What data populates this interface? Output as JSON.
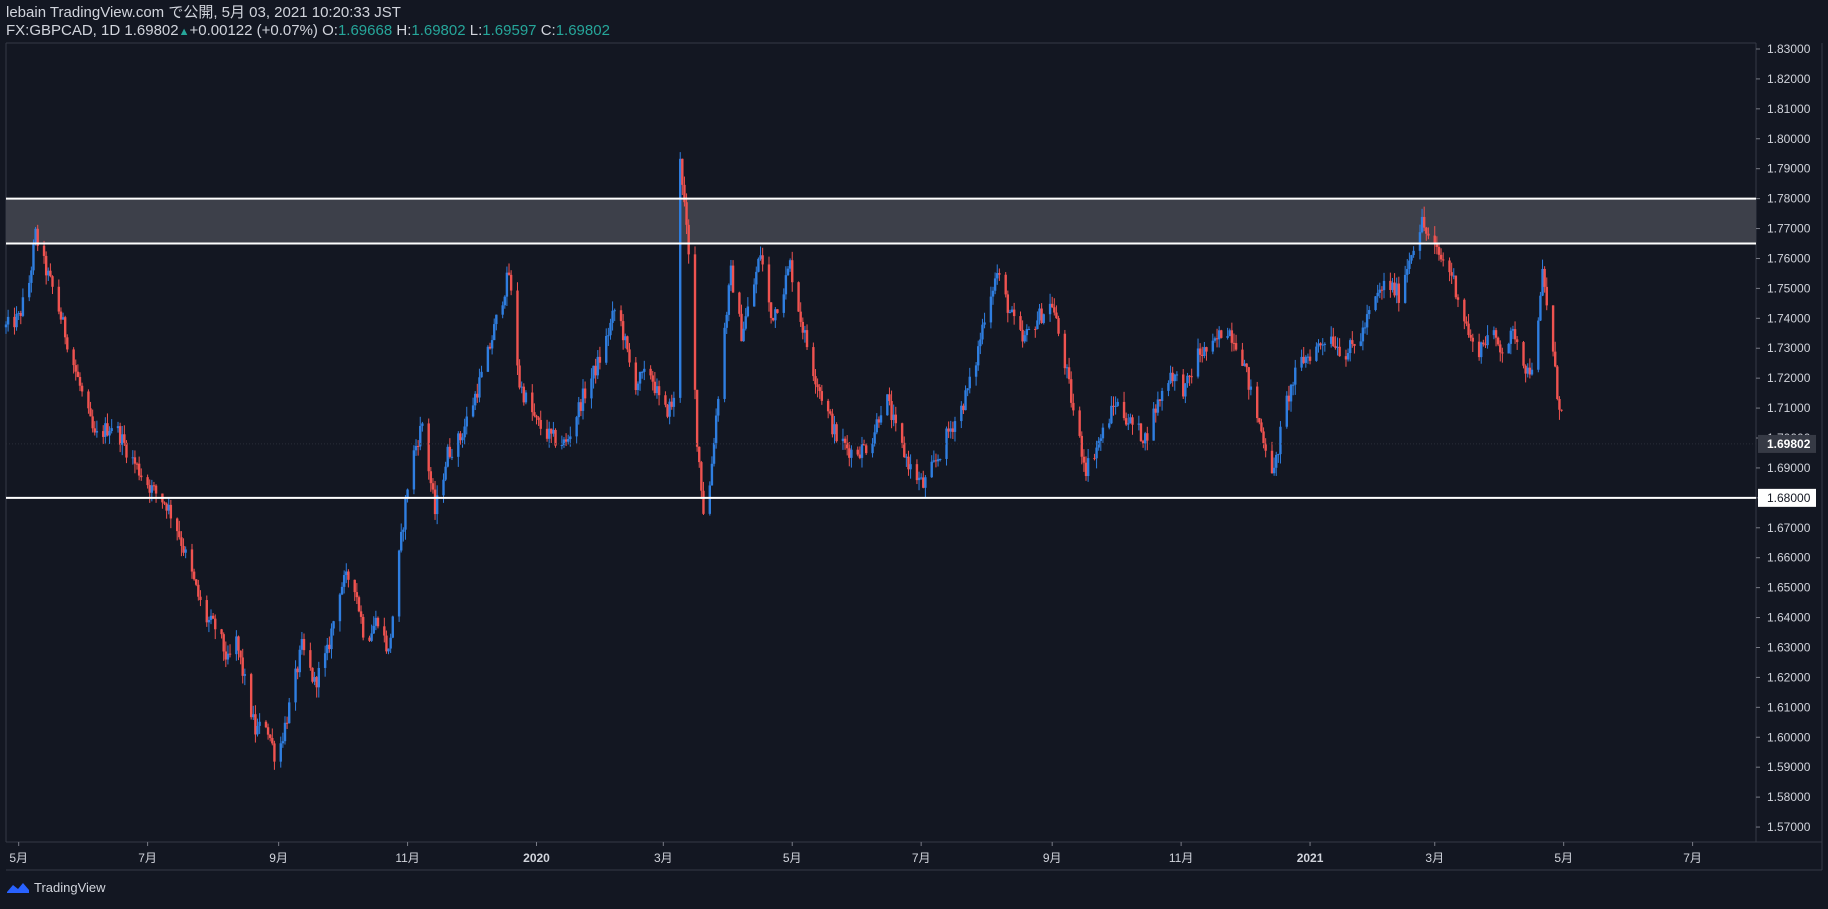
{
  "header": {
    "line1": "lebain TradingView.com で公開, 5月 03, 2021 10:20:33 JST",
    "symbol": "FX:GBPCAD, 1D",
    "last": "1.69802",
    "change": "+0.00122 (+0.07%)",
    "o_key": "O:",
    "o_val": "1.69668",
    "h_key": "H:",
    "h_val": "1.69802",
    "l_key": "L:",
    "l_val": "1.69597",
    "c_key": "C:",
    "c_val": "1.69802"
  },
  "footer": {
    "brand": "TradingView"
  },
  "colors": {
    "bg": "#131722",
    "up": "#2f7ee0",
    "down": "#ef5350",
    "grid": "#363a45",
    "text": "#d1d4dc",
    "zone": "#3d404a"
  },
  "chart_data": {
    "type": "candlestick",
    "title": "FX:GBPCAD, 1D",
    "ylim": [
      1.565,
      1.832
    ],
    "y_ticks": [
      "1.57000",
      "1.58000",
      "1.59000",
      "1.60000",
      "1.61000",
      "1.62000",
      "1.63000",
      "1.64000",
      "1.65000",
      "1.66000",
      "1.67000",
      "1.68000",
      "1.69000",
      "1.70000",
      "1.71000",
      "1.72000",
      "1.73000",
      "1.74000",
      "1.75000",
      "1.76000",
      "1.77000",
      "1.78000",
      "1.79000",
      "1.80000",
      "1.81000",
      "1.82000",
      "1.83000"
    ],
    "x_range": [
      "2019-04-25",
      "2021-07-31"
    ],
    "x_ticks": [
      {
        "date": "2019-05-01",
        "label": "5月"
      },
      {
        "date": "2019-07-01",
        "label": "7月"
      },
      {
        "date": "2019-09-01",
        "label": "9月"
      },
      {
        "date": "2019-11-01",
        "label": "11月"
      },
      {
        "date": "2020-01-01",
        "label": "2020"
      },
      {
        "date": "2020-03-01",
        "label": "3月"
      },
      {
        "date": "2020-05-01",
        "label": "5月"
      },
      {
        "date": "2020-07-01",
        "label": "7月"
      },
      {
        "date": "2020-09-01",
        "label": "9月"
      },
      {
        "date": "2020-11-01",
        "label": "11月"
      },
      {
        "date": "2021-01-01",
        "label": "2021"
      },
      {
        "date": "2021-03-01",
        "label": "3月"
      },
      {
        "date": "2021-05-01",
        "label": "5月"
      },
      {
        "date": "2021-07-01",
        "label": "7月"
      }
    ],
    "price_path": [
      [
        "2019-04-25",
        1.737
      ],
      [
        "2019-05-01",
        1.74
      ],
      [
        "2019-05-06",
        1.752
      ],
      [
        "2019-05-09",
        1.768
      ],
      [
        "2019-05-12",
        1.76
      ],
      [
        "2019-05-18",
        1.748
      ],
      [
        "2019-05-25",
        1.73
      ],
      [
        "2019-06-01",
        1.712
      ],
      [
        "2019-06-06",
        1.7
      ],
      [
        "2019-06-15",
        1.705
      ],
      [
        "2019-06-22",
        1.695
      ],
      [
        "2019-06-28",
        1.688
      ],
      [
        "2019-07-03",
        1.683
      ],
      [
        "2019-07-10",
        1.678
      ],
      [
        "2019-07-15",
        1.67
      ],
      [
        "2019-07-22",
        1.654
      ],
      [
        "2019-07-28",
        1.64
      ],
      [
        "2019-08-03",
        1.636
      ],
      [
        "2019-08-08",
        1.625
      ],
      [
        "2019-08-12",
        1.632
      ],
      [
        "2019-08-17",
        1.615
      ],
      [
        "2019-08-21",
        1.602
      ],
      [
        "2019-08-26",
        1.605
      ],
      [
        "2019-08-31",
        1.592
      ],
      [
        "2019-09-06",
        1.61
      ],
      [
        "2019-09-12",
        1.63
      ],
      [
        "2019-09-18",
        1.618
      ],
      [
        "2019-09-24",
        1.628
      ],
      [
        "2019-09-30",
        1.65
      ],
      [
        "2019-10-06",
        1.655
      ],
      [
        "2019-10-12",
        1.632
      ],
      [
        "2019-10-18",
        1.64
      ],
      [
        "2019-10-23",
        1.628
      ],
      [
        "2019-10-28",
        1.66
      ],
      [
        "2019-11-02",
        1.69
      ],
      [
        "2019-11-08",
        1.705
      ],
      [
        "2019-11-14",
        1.675
      ],
      [
        "2019-11-20",
        1.695
      ],
      [
        "2019-11-26",
        1.7
      ],
      [
        "2019-12-02",
        1.712
      ],
      [
        "2019-12-08",
        1.725
      ],
      [
        "2019-12-14",
        1.742
      ],
      [
        "2019-12-19",
        1.755
      ],
      [
        "2019-12-24",
        1.718
      ],
      [
        "2020-01-01",
        1.705
      ],
      [
        "2020-01-08",
        1.7
      ],
      [
        "2020-01-15",
        1.698
      ],
      [
        "2020-01-22",
        1.712
      ],
      [
        "2020-02-01",
        1.728
      ],
      [
        "2020-02-08",
        1.745
      ],
      [
        "2020-02-16",
        1.718
      ],
      [
        "2020-02-24",
        1.722
      ],
      [
        "2020-03-01",
        1.708
      ],
      [
        "2020-03-06",
        1.712
      ],
      [
        "2020-03-09",
        1.795
      ],
      [
        "2020-03-13",
        1.76
      ],
      [
        "2020-03-17",
        1.7
      ],
      [
        "2020-03-21",
        1.668
      ],
      [
        "2020-03-25",
        1.7
      ],
      [
        "2020-03-29",
        1.73
      ],
      [
        "2020-04-02",
        1.755
      ],
      [
        "2020-04-07",
        1.735
      ],
      [
        "2020-04-12",
        1.748
      ],
      [
        "2020-04-16",
        1.762
      ],
      [
        "2020-04-21",
        1.74
      ],
      [
        "2020-04-26",
        1.748
      ],
      [
        "2020-04-30",
        1.758
      ],
      [
        "2020-05-05",
        1.74
      ],
      [
        "2020-05-10",
        1.725
      ],
      [
        "2020-05-16",
        1.712
      ],
      [
        "2020-05-22",
        1.7
      ],
      [
        "2020-05-30",
        1.695
      ],
      [
        "2020-06-07",
        1.698
      ],
      [
        "2020-06-14",
        1.715
      ],
      [
        "2020-06-20",
        1.7
      ],
      [
        "2020-06-26",
        1.69
      ],
      [
        "2020-07-02",
        1.684
      ],
      [
        "2020-07-08",
        1.692
      ],
      [
        "2020-07-14",
        1.702
      ],
      [
        "2020-07-20",
        1.71
      ],
      [
        "2020-07-26",
        1.722
      ],
      [
        "2020-08-01",
        1.745
      ],
      [
        "2020-08-06",
        1.755
      ],
      [
        "2020-08-12",
        1.742
      ],
      [
        "2020-08-18",
        1.732
      ],
      [
        "2020-08-25",
        1.74
      ],
      [
        "2020-09-01",
        1.745
      ],
      [
        "2020-09-07",
        1.725
      ],
      [
        "2020-09-12",
        1.705
      ],
      [
        "2020-09-17",
        1.69
      ],
      [
        "2020-09-24",
        1.7
      ],
      [
        "2020-10-01",
        1.712
      ],
      [
        "2020-10-08",
        1.705
      ],
      [
        "2020-10-15",
        1.7
      ],
      [
        "2020-10-20",
        1.71
      ],
      [
        "2020-10-27",
        1.722
      ],
      [
        "2020-11-03",
        1.716
      ],
      [
        "2020-11-09",
        1.728
      ],
      [
        "2020-11-16",
        1.73
      ],
      [
        "2020-11-22",
        1.738
      ],
      [
        "2020-11-29",
        1.73
      ],
      [
        "2020-12-05",
        1.712
      ],
      [
        "2020-12-10",
        1.7
      ],
      [
        "2020-12-15",
        1.688
      ],
      [
        "2020-12-20",
        1.71
      ],
      [
        "2020-12-27",
        1.725
      ],
      [
        "2021-01-04",
        1.73
      ],
      [
        "2021-01-10",
        1.735
      ],
      [
        "2021-01-17",
        1.728
      ],
      [
        "2021-01-24",
        1.732
      ],
      [
        "2021-01-31",
        1.745
      ],
      [
        "2021-02-06",
        1.752
      ],
      [
        "2021-02-12",
        1.748
      ],
      [
        "2021-02-19",
        1.765
      ],
      [
        "2021-02-23",
        1.772
      ],
      [
        "2021-02-27",
        1.765
      ],
      [
        "2021-03-04",
        1.76
      ],
      [
        "2021-03-09",
        1.755
      ],
      [
        "2021-03-15",
        1.74
      ],
      [
        "2021-03-20",
        1.728
      ],
      [
        "2021-03-27",
        1.735
      ],
      [
        "2021-04-02",
        1.73
      ],
      [
        "2021-04-08",
        1.735
      ],
      [
        "2021-04-14",
        1.722
      ],
      [
        "2021-04-18",
        1.728
      ],
      [
        "2021-04-21",
        1.755
      ],
      [
        "2021-04-25",
        1.735
      ],
      [
        "2021-04-28",
        1.715
      ],
      [
        "2021-05-03",
        1.698
      ]
    ],
    "horizontal_lines": [
      {
        "price": 1.78
      },
      {
        "price": 1.765
      },
      {
        "price": 1.68,
        "label": "1.68000"
      }
    ],
    "zones": [
      {
        "from": 1.765,
        "to": 1.78
      }
    ],
    "last_price": {
      "price": 1.69802,
      "label": "1.69802"
    }
  }
}
